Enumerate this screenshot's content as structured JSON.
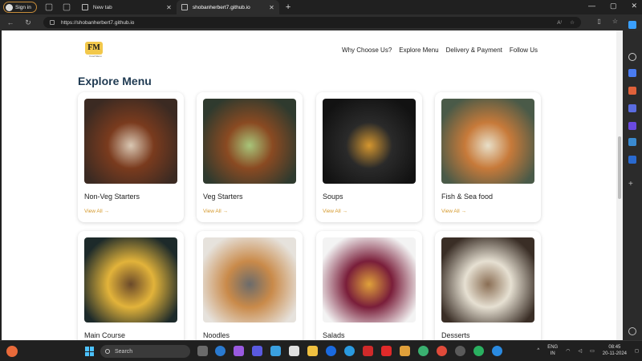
{
  "browser": {
    "signin_label": "Sign in",
    "tabs": [
      {
        "title": "New tab"
      },
      {
        "title": "shobanherbert7.github.io"
      }
    ],
    "new_tab_glyph": "+",
    "url": "https://shobanherbert7.github.io"
  },
  "site": {
    "logo_text": "FM",
    "logo_subtext": "Food Menu",
    "nav": [
      "Why Choose Us?",
      "Explore Menu",
      "Delivery & Payment",
      "Follow Us"
    ],
    "section_title": "Explore Menu",
    "view_all_label": "View All →",
    "cards": [
      {
        "title": "Non-Veg Starters",
        "image": "non-veg-starters-photo",
        "colors": [
          "#3b2a22",
          "#7a3b1e",
          "#d9c7b3"
        ]
      },
      {
        "title": "Veg Starters",
        "image": "veg-starters-photo",
        "colors": [
          "#2f3a2e",
          "#8a4a22",
          "#a8c57a"
        ]
      },
      {
        "title": "Soups",
        "image": "soups-photo",
        "colors": [
          "#121212",
          "#2a2a2a",
          "#d4962f"
        ]
      },
      {
        "title": "Fish & Sea food",
        "image": "fish-seafood-photo",
        "colors": [
          "#4a5a48",
          "#c77a3a",
          "#e8dfc8"
        ]
      },
      {
        "title": "Main Course",
        "image": "main-course-photo",
        "colors": [
          "#1d2a2a",
          "#e2b33a",
          "#6b4a2a"
        ]
      },
      {
        "title": "Noodles",
        "image": "noodles-photo",
        "colors": [
          "#e6e2dc",
          "#c98a4a",
          "#6b6b6b"
        ]
      },
      {
        "title": "Salads",
        "image": "salads-photo",
        "colors": [
          "#f3f3f3",
          "#7a1e3a",
          "#e0a13a"
        ]
      },
      {
        "title": "Desserts",
        "image": "desserts-photo",
        "colors": [
          "#3a2e26",
          "#e6e0d2",
          "#8a6e54"
        ]
      }
    ]
  },
  "taskbar": {
    "search_placeholder": "Search",
    "lang": "ENG",
    "region": "IN",
    "time": "08:45",
    "date": "20-11-2024"
  }
}
